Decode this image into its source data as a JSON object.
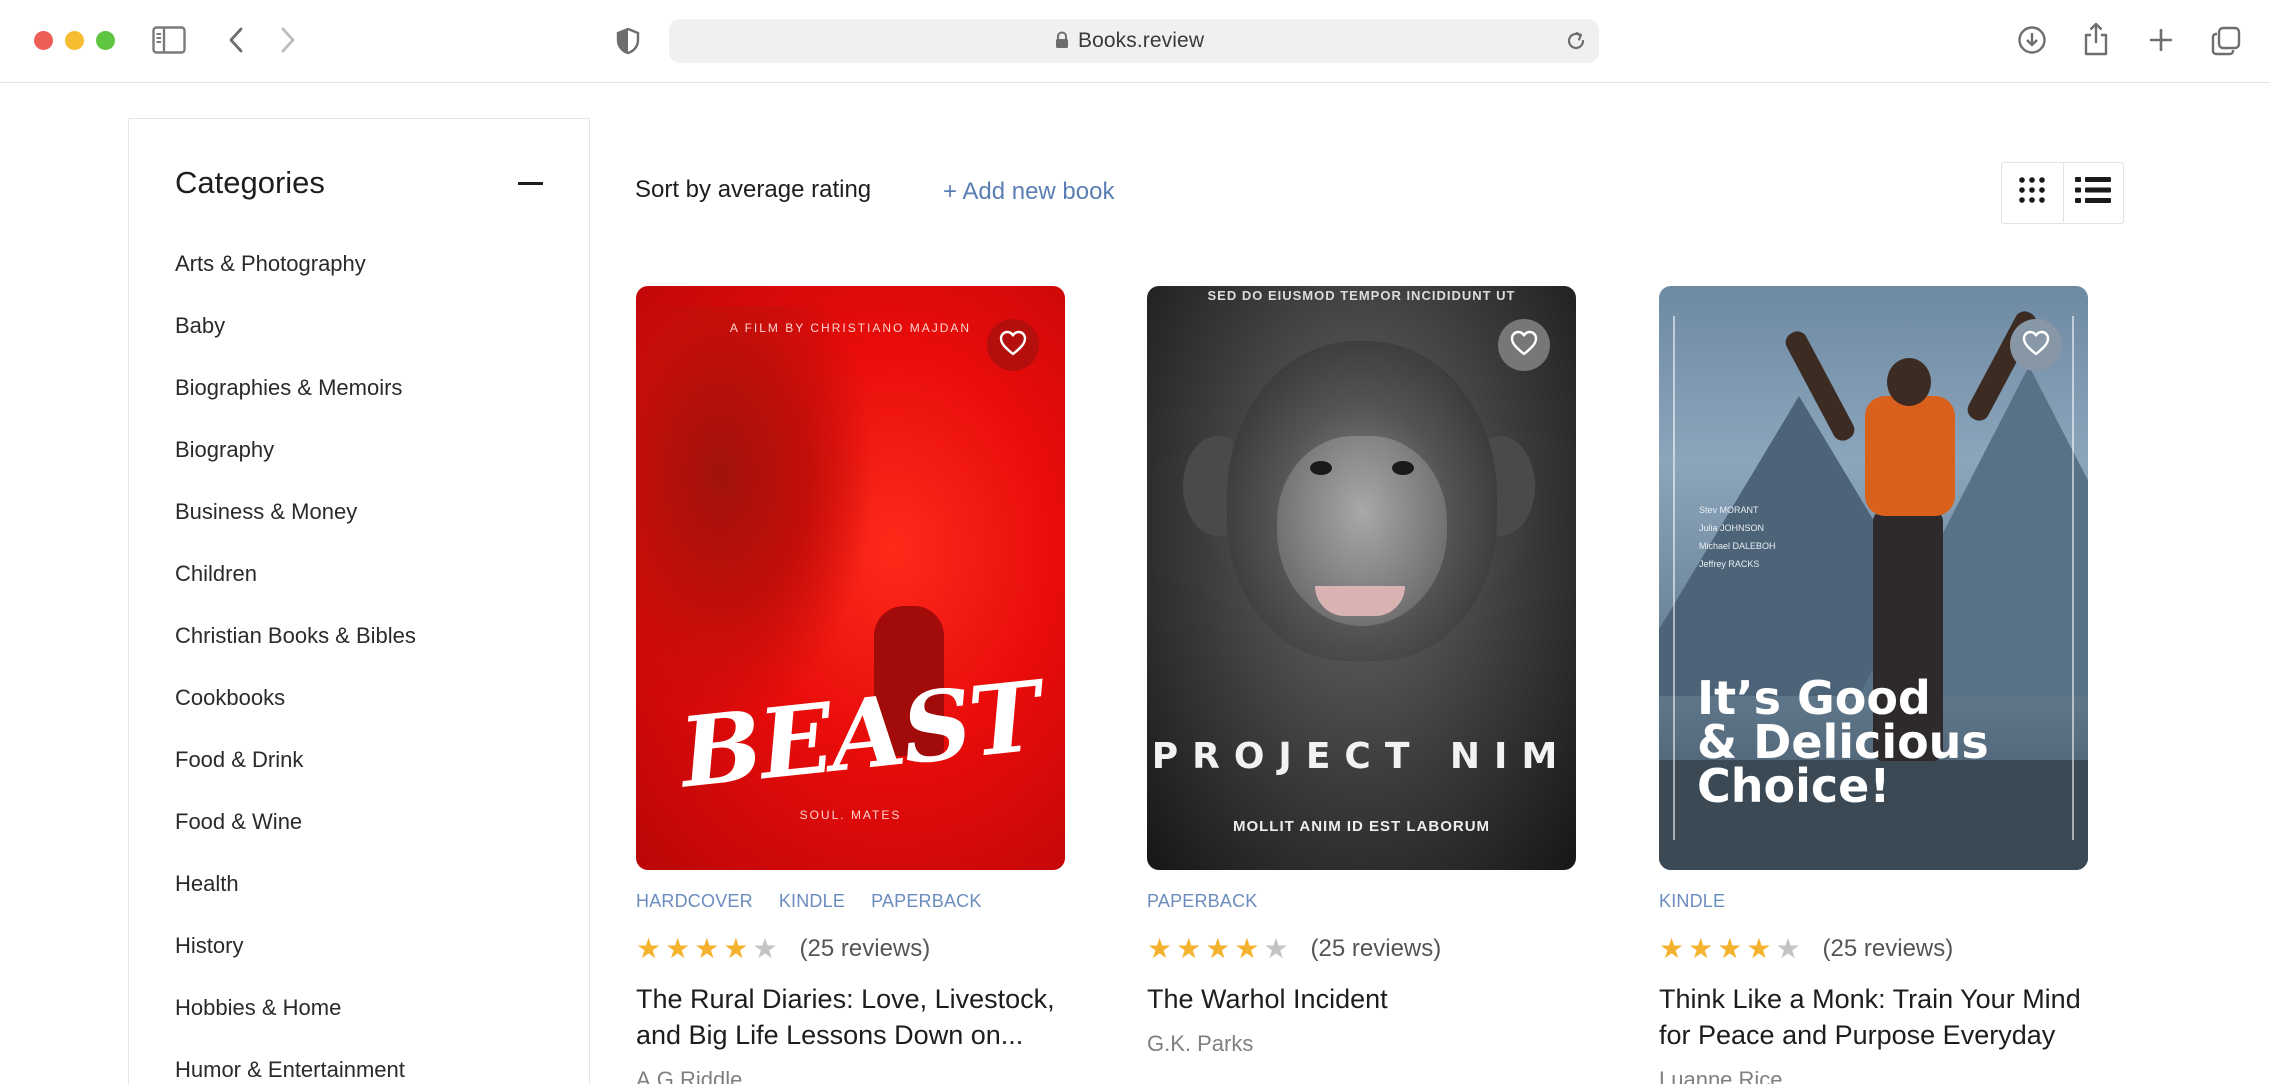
{
  "browser": {
    "url": "Books.review"
  },
  "sidebar": {
    "title": "Categories",
    "categories": [
      "Arts & Photography",
      "Baby",
      "Biographies & Memoirs",
      "Biography",
      "Business & Money",
      "Children",
      "Christian Books & Bibles",
      "Cookbooks",
      "Food & Drink",
      "Food & Wine",
      "Health",
      "History",
      "Hobbies & Home",
      "Humor & Entertainment"
    ]
  },
  "toolbar": {
    "sort_label": "Sort by average rating",
    "add_book_label": "+ Add new book"
  },
  "books": [
    {
      "title": "The Rural Diaries: Love, Livestock, and Big Life Lessons Down on...",
      "author": "A.G Riddle",
      "formats": [
        "HARDCOVER",
        "KINDLE",
        "PAPERBACK"
      ],
      "rating": 4,
      "reviews": "(25 reviews)",
      "cover": {
        "kicker": "A FILM BY CHRISTIANO MAJDAN",
        "title": "BEAST",
        "sub": "SOUL. MATES"
      }
    },
    {
      "title": "The Warhol Incident",
      "author": "G.K. Parks",
      "formats": [
        "PAPERBACK"
      ],
      "rating": 4,
      "reviews": "(25 reviews)",
      "cover": {
        "kicker": "SED DO EIUSMOD TEMPOR INCIDIDUNT UT",
        "title": "PROJECT NIM",
        "sub": "MOLLIT ANIM ID EST LABORUM"
      }
    },
    {
      "title": "Think Like a Monk: Train Your Mind for Peace and Purpose Everyday",
      "author": "Luanne Rice",
      "formats": [
        "KINDLE"
      ],
      "rating": 4,
      "reviews": "(25 reviews)",
      "cover": {
        "credits": [
          "Stev MORANT",
          "Julia JOHNSON",
          "Michael DALEBOH",
          "Jeffrey RACKS"
        ],
        "title_lines": [
          "It’s Good",
          "& Delicious",
          "Choice!"
        ]
      }
    }
  ],
  "colors": {
    "accent_link": "#5b7fb5",
    "format_tag": "#6b8cbd",
    "star_on": "#f5b22e",
    "star_off": "#c4c4c4"
  },
  "icons": {
    "view_grid": "grid-icon",
    "view_list": "list-icon",
    "favorite": "heart-icon"
  }
}
